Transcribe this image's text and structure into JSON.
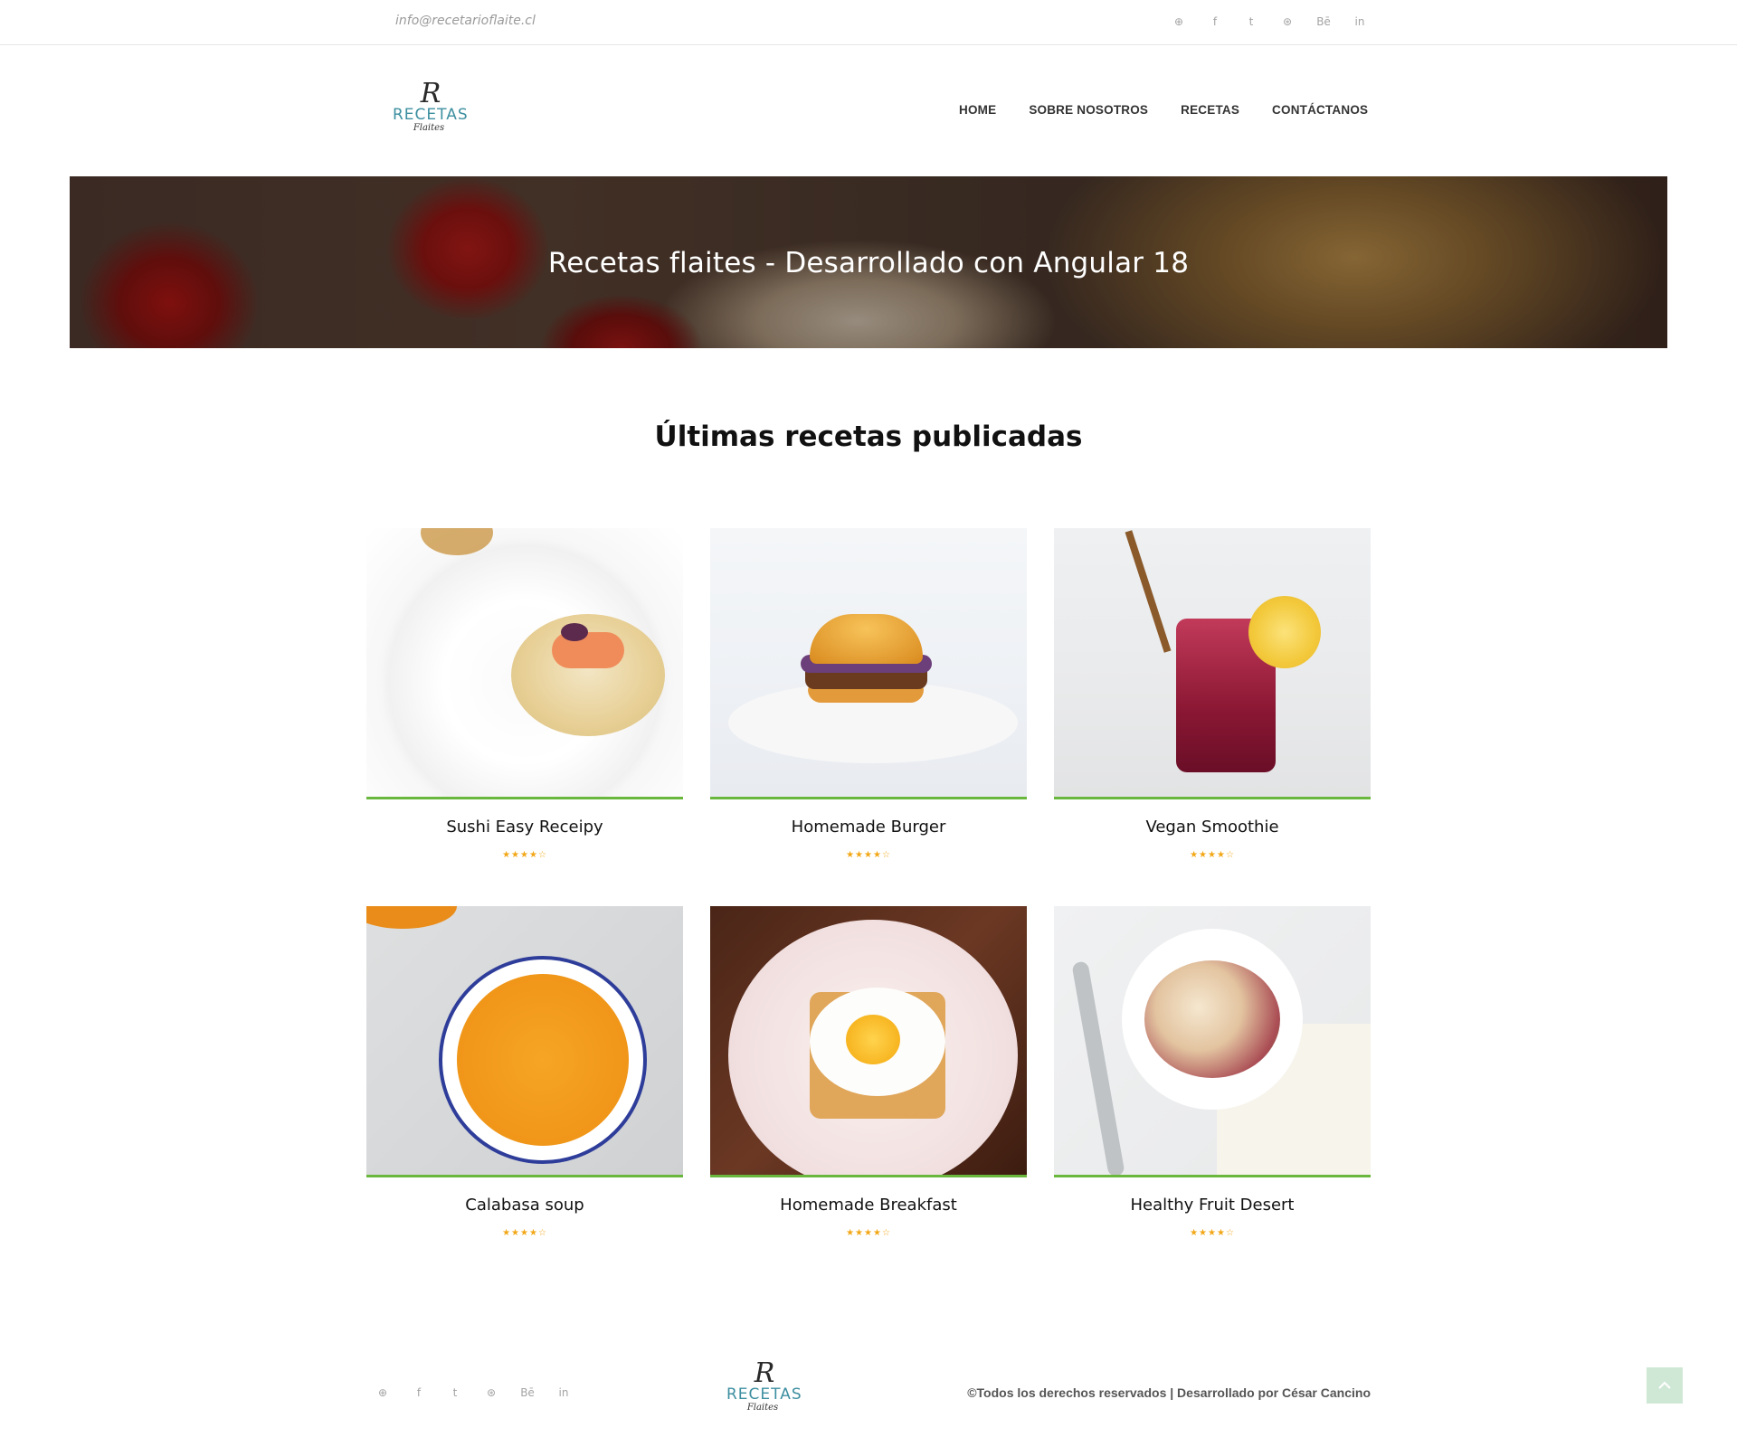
{
  "topbar": {
    "email": "info@recetarioflaite.cl",
    "social": [
      {
        "icon": "pinterest-icon",
        "glyph": "⊕"
      },
      {
        "icon": "facebook-icon",
        "glyph": "f"
      },
      {
        "icon": "twitter-icon",
        "glyph": "t"
      },
      {
        "icon": "dribbble-icon",
        "glyph": "⊛"
      },
      {
        "icon": "behance-icon",
        "glyph": "Bē"
      },
      {
        "icon": "linkedin-icon",
        "glyph": "in"
      }
    ]
  },
  "logo": {
    "initial": "R",
    "title": "RECETAS",
    "subtitle": "Flaites"
  },
  "nav": {
    "items": [
      "HOME",
      "SOBRE NOSOTROS",
      "RECETAS",
      "CONTÁCTANOS"
    ]
  },
  "banner": {
    "title": "Recetas flaites - Desarrollado con Angular 18"
  },
  "section": {
    "title": "Últimas recetas publicadas"
  },
  "recipes": [
    {
      "name": "Sushi Easy Receipy",
      "rating": 4,
      "stars": "★★★★☆"
    },
    {
      "name": "Homemade Burger",
      "rating": 4,
      "stars": "★★★★☆"
    },
    {
      "name": "Vegan Smoothie",
      "rating": 4,
      "stars": "★★★★☆"
    },
    {
      "name": "Calabasa soup",
      "rating": 4,
      "stars": "★★★★☆"
    },
    {
      "name": "Homemade Breakfast",
      "rating": 4,
      "stars": "★★★★☆"
    },
    {
      "name": "Healthy Fruit Desert",
      "rating": 4,
      "stars": "★★★★☆"
    }
  ],
  "footer": {
    "copyright": "©Todos los derechos reservados | Desarrollado por César Cancino",
    "scroll_top_icon": "chevron-up-icon"
  },
  "colors": {
    "accent_green": "#6ab73d",
    "star": "#f2a716",
    "logo_teal": "#3d8fa0"
  }
}
